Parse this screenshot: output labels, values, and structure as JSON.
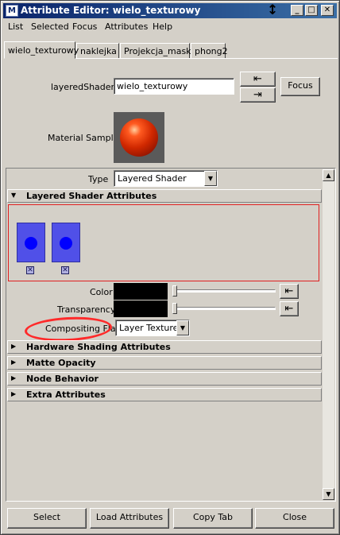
{
  "window": {
    "title": "Attribute Editor: wielo_texturowy",
    "icon_text": "M",
    "resize_cursor": "↕",
    "minimize": "_",
    "maximize": "□",
    "close": "✕"
  },
  "menu": [
    "List",
    "Selected",
    "Focus",
    "Attributes",
    "Help"
  ],
  "tabs": [
    "wielo_texturowy",
    "naklejka",
    "Projekcja_maski",
    "phong2"
  ],
  "node": {
    "label": "layeredShader:",
    "value": "wielo_texturowy",
    "focus_label": "Focus",
    "input_icon": "⇤",
    "output_icon": "⇥"
  },
  "material_sample_label": "Material Sample",
  "type": {
    "label": "Type",
    "value": "Layered Shader"
  },
  "sections": {
    "layered": "Layered Shader Attributes",
    "hardware": "Hardware Shading Attributes",
    "matte": "Matte Opacity",
    "node_behavior": "Node Behavior",
    "extra": "Extra Attributes"
  },
  "attributes": {
    "color_label": "Color",
    "transparency_label": "Transparency",
    "compositing_label": "Compositing Flag",
    "compositing_value": "Layer Texture",
    "map_icon": "⇤"
  },
  "layer_remove_glyph": "✕",
  "arrows": {
    "expanded": "▼",
    "collapsed": "▶",
    "up": "▲",
    "down": "▼"
  },
  "bottom_buttons": [
    "Select",
    "Load Attributes",
    "Copy Tab",
    "Close"
  ],
  "colors": {
    "title_bar": "#0a246a",
    "layer_thumb": "#5050e8",
    "annotation": "#ff2a2a",
    "sample_sphere": "#d02800"
  }
}
